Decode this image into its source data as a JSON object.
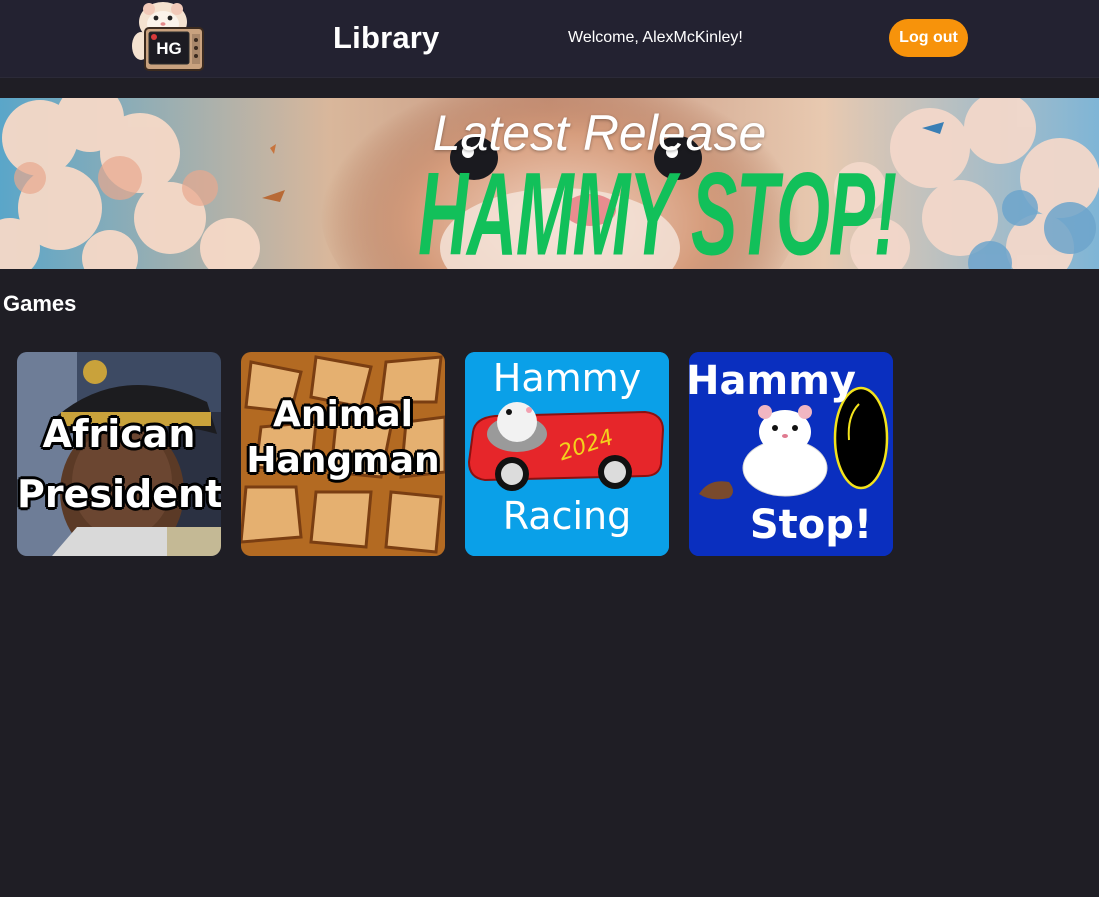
{
  "header": {
    "logo_text": "HG",
    "title": "Library",
    "welcome": "Welcome, AlexMcKinley!",
    "logout_label": "Log out"
  },
  "banner": {
    "subtitle": "Latest Release",
    "title": "HAMMY STOP!"
  },
  "games_section": {
    "title": "Games",
    "games": [
      {
        "line1": "African",
        "line2": "President"
      },
      {
        "line1": "Animal",
        "line2": "Hangman"
      },
      {
        "line1": "Hammy",
        "line2": "Racing",
        "badge": "2024"
      },
      {
        "line1": "Hammy",
        "line2": "Stop!"
      }
    ]
  },
  "colors": {
    "background": "#1f1e25",
    "topbar": "#232231",
    "logout_button": "#f7930b",
    "banner_title": "#12c05a",
    "racing_card": "#0aa0e8",
    "stop_card": "#0a2fbf"
  }
}
